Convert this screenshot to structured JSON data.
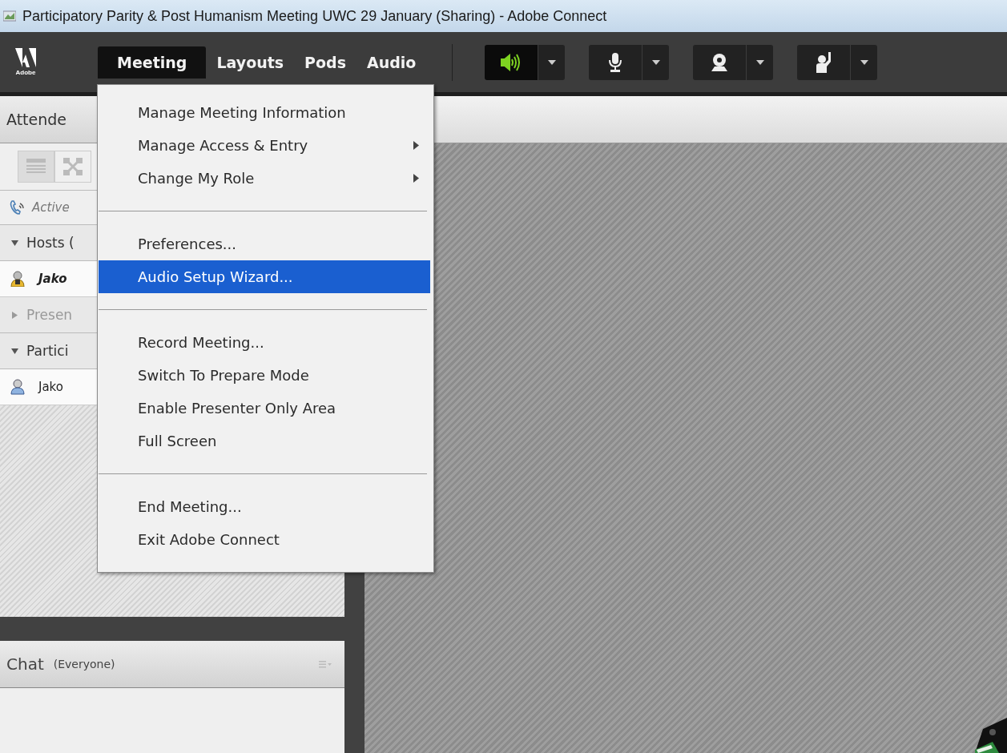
{
  "window": {
    "title": "Participatory Parity & Post Humanism Meeting UWC 29 January (Sharing) - Adobe Connect"
  },
  "logo": {
    "text": "Adobe"
  },
  "menubar": [
    {
      "label": "Meeting",
      "selected": true
    },
    {
      "label": "Layouts",
      "selected": false
    },
    {
      "label": "Pods",
      "selected": false
    },
    {
      "label": "Audio",
      "selected": false
    }
  ],
  "toolbar": [
    {
      "kind": "speaker",
      "on": true
    },
    {
      "kind": "microphone",
      "on": false
    },
    {
      "kind": "webcam",
      "on": false
    },
    {
      "kind": "raise-hand",
      "on": false
    }
  ],
  "attendees": {
    "title": "Attende",
    "status": "Active",
    "groups": [
      {
        "label": "Hosts (",
        "expanded": true,
        "disabled": false,
        "children": [
          {
            "name": "Jako",
            "kind": "host"
          }
        ]
      },
      {
        "label": "Presen",
        "expanded": false,
        "disabled": true
      },
      {
        "label": "Partici",
        "expanded": true,
        "disabled": false,
        "children": [
          {
            "name": "Jako",
            "kind": "participant"
          }
        ]
      }
    ]
  },
  "chat": {
    "title": "Chat",
    "scope": "(Everyone)"
  },
  "menu": {
    "groups": [
      [
        {
          "label": "Manage Meeting Information",
          "submenu": false,
          "selected": false
        },
        {
          "label": "Manage Access & Entry",
          "submenu": true,
          "selected": false
        },
        {
          "label": "Change My Role",
          "submenu": true,
          "selected": false
        }
      ],
      [
        {
          "label": "Preferences...",
          "submenu": false,
          "selected": false
        },
        {
          "label": "Audio Setup Wizard...",
          "submenu": false,
          "selected": true
        }
      ],
      [
        {
          "label": "Record Meeting...",
          "submenu": false,
          "selected": false
        },
        {
          "label": "Switch To Prepare Mode",
          "submenu": false,
          "selected": false
        },
        {
          "label": "Enable Presenter Only Area",
          "submenu": false,
          "selected": false
        },
        {
          "label": "Full Screen",
          "submenu": false,
          "selected": false
        }
      ],
      [
        {
          "label": "End Meeting...",
          "submenu": false,
          "selected": false
        },
        {
          "label": "Exit Adobe Connect",
          "submenu": false,
          "selected": false
        }
      ]
    ]
  }
}
